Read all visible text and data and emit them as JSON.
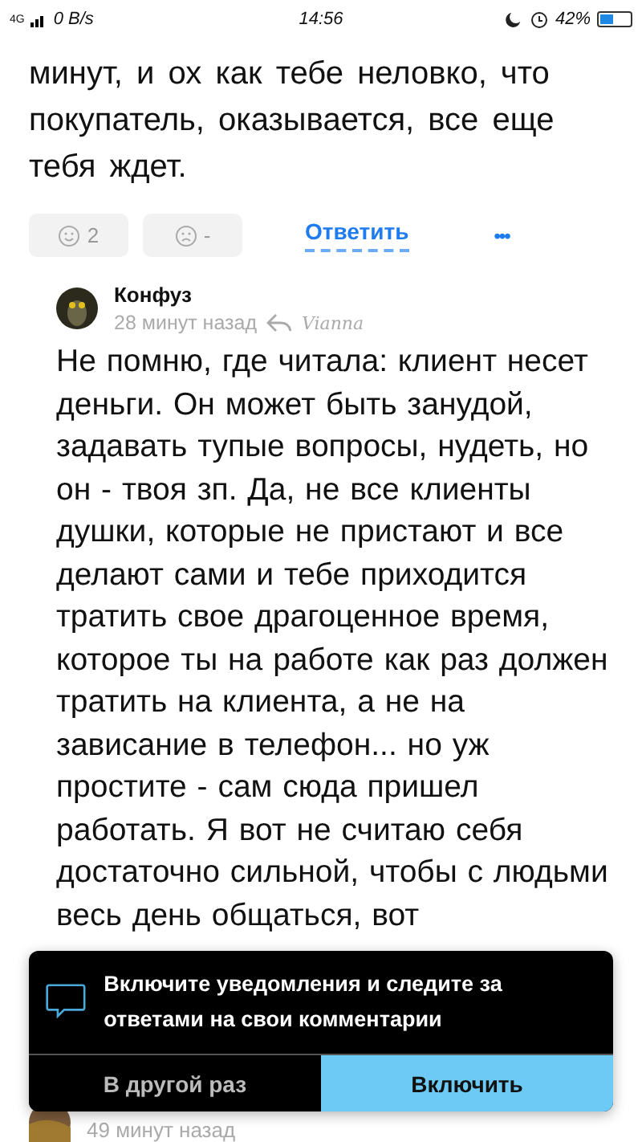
{
  "status_bar": {
    "network": "4G",
    "speed": "0 B/s",
    "time": "14:56",
    "battery": "42%"
  },
  "previous_comment": {
    "text": "минут, и ох как тебе неловко, что покупатель, оказывается, все еще тебя ждет.",
    "likes": "2",
    "dislikes": "-",
    "reply": "Ответить",
    "more": "•••"
  },
  "reply_comment": {
    "author": "Конфуз",
    "time": "28 минут назад",
    "reply_to": "Vianna",
    "text": "Не помню, где читала: клиент несет деньги. Он может быть занудой, задавать тупые вопросы, нудеть, но он - твоя зп. Да, не все клиенты душки, которые не пристают и все делают сами и тебе приходится тратить свое драгоценное время, которое ты на работе как раз должен тратить на клиента, а не на зависание в телефон... но уж простите - сам сюда пришел работать. Я вот не считаю себя достаточно сильной, чтобы с людьми весь день общаться, вот"
  },
  "next_comment": {
    "time": "49 минут назад"
  },
  "notification_banner": {
    "message": "Включите уведомления и следите за ответами на свои комментарии",
    "buttons": [
      {
        "label": "В другой раз",
        "primary": false
      },
      {
        "label": "Включить",
        "primary": true
      }
    ]
  }
}
